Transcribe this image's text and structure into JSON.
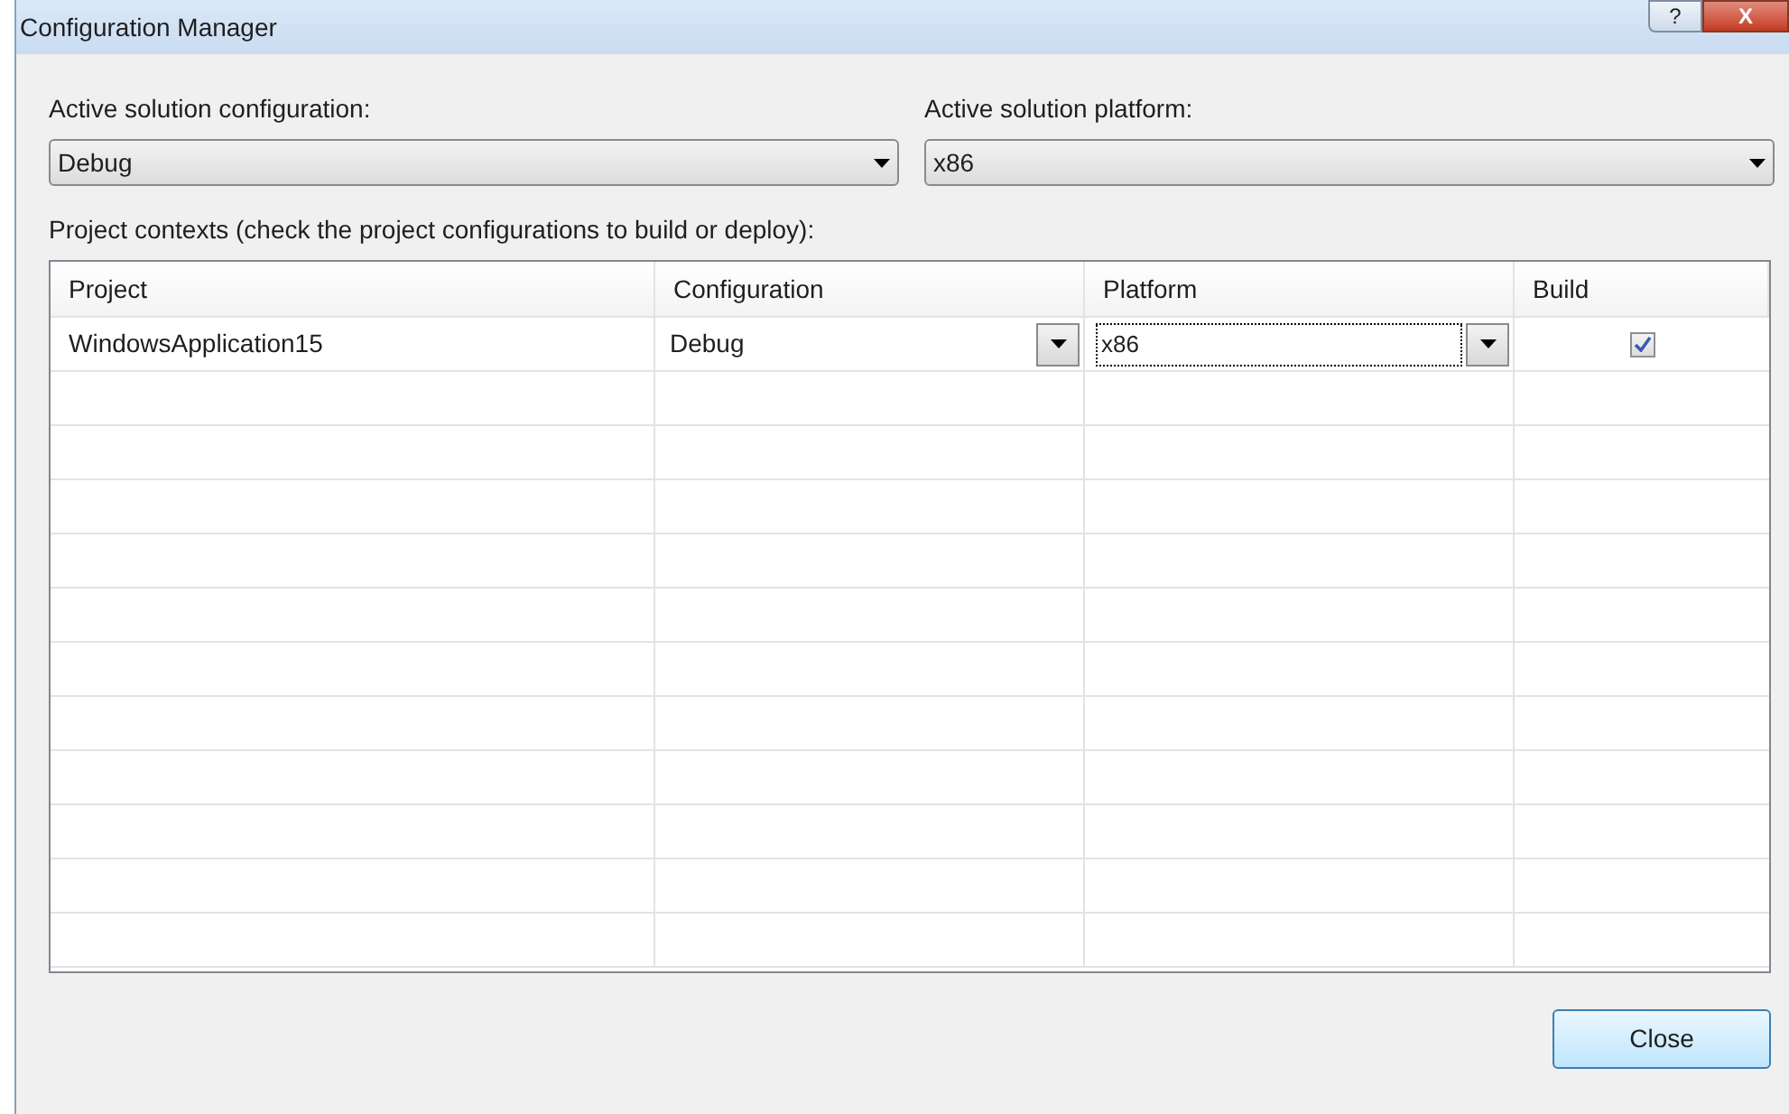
{
  "window": {
    "title": "Configuration Manager",
    "buttons": [
      "?",
      "X"
    ]
  },
  "active_configuration": {
    "label": "Active solution configuration:",
    "value": "Debug"
  },
  "active_platform": {
    "label": "Active solution platform:",
    "value": "x86"
  },
  "project_contexts": {
    "label": "Project contexts (check the project configurations to build or deploy):",
    "columns": [
      "Project",
      "Configuration",
      "Platform",
      "Build"
    ],
    "rows": [
      {
        "project": "WindowsApplication15",
        "configuration": "Debug",
        "platform": "x86",
        "build": true
      }
    ]
  },
  "buttons": [
    "Close"
  ]
}
